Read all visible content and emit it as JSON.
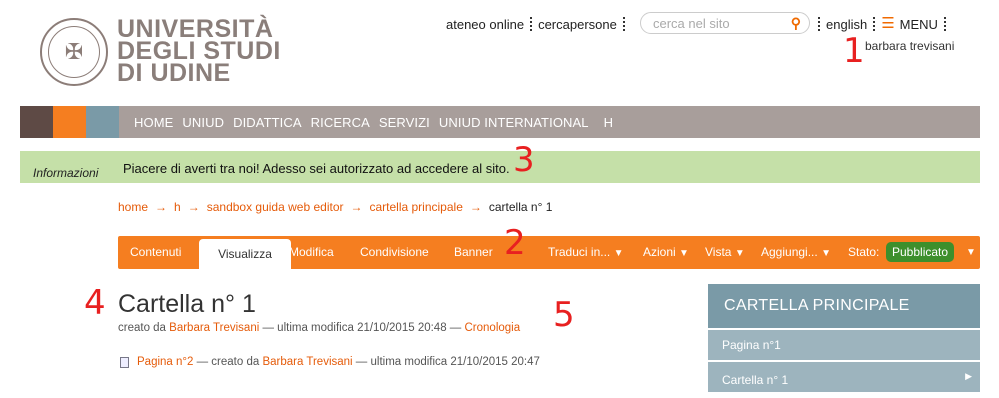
{
  "logo": {
    "line1": "UNIVERSITÀ",
    "line2": "DEGLI STUDI",
    "line3": "DI UDINE"
  },
  "top_links": {
    "ateneo": "ateneo online",
    "cercapersone": "cercapersone"
  },
  "search": {
    "placeholder": "cerca nel sito"
  },
  "right_links": {
    "english": "english",
    "menu": "MENU"
  },
  "user": {
    "name": "barbara trevisani"
  },
  "markers": {
    "m1": "1",
    "m2": "2",
    "m3": "3",
    "m4": "4",
    "m5": "5"
  },
  "colors": {
    "swatch1": "#5e4a45",
    "swatch2": "#f57e20",
    "swatch3": "#7a9aa7",
    "nav_bg": "#a89e9b",
    "accent": "#f57e20",
    "info_bg": "#c5e0a8",
    "status": "#3d8f2c"
  },
  "nav": {
    "items": [
      "HOME",
      "UNIUD",
      "DIDATTICA",
      "RICERCA",
      "SERVIZI",
      "UNIUD INTERNATIONAL",
      "H"
    ]
  },
  "info": {
    "label": "Informazioni",
    "message": "Piacere di averti tra noi! Adesso sei autorizzato ad accedere al sito."
  },
  "breadcrumb": {
    "items": [
      "home",
      "h",
      "sandbox guida web editor",
      "cartella principale"
    ],
    "arrow": "→",
    "current": "cartella n° 1"
  },
  "toolbar": {
    "contenuti": "Contenuti",
    "visualizza": "Visualizza",
    "modifica": "Modifica",
    "condivisione": "Condivisione",
    "banner": "Banner",
    "traduci": "Traduci in...",
    "azioni": "Azioni",
    "vista": "Vista",
    "aggiungi": "Aggiungi...",
    "stato_label": "Stato:",
    "stato_value": "Pubblicato",
    "caret": "▼"
  },
  "content": {
    "title": "Cartella n° 1",
    "meta_prefix": "creato da",
    "author": "Barbara Trevisani",
    "meta_mid": "— ultima modifica 21/10/2015 20:48 —",
    "history": "Cronologia",
    "item_link": "Pagina n°2",
    "item_prefix": "— creato da",
    "item_author": "Barbara Trevisani",
    "item_suffix": "— ultima modifica 21/10/2015 20:47"
  },
  "side": {
    "heading": "CARTELLA PRINCIPALE",
    "items": [
      "Pagina n°1",
      "Cartella n° 1"
    ]
  }
}
